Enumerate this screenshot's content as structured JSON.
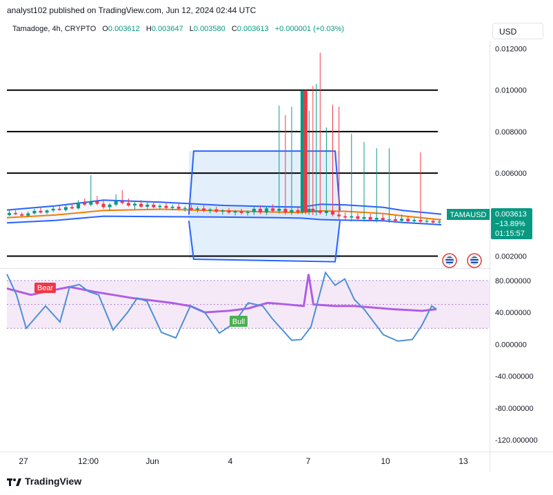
{
  "header": {
    "published": "analyst102 published on TradingView.com, Jun 12, 2024 02:44 UTC"
  },
  "symbol_bar": {
    "name": "Tamadoge, 4h, CRYPTO",
    "open_label": "O",
    "open": "0.003612",
    "high_label": "H",
    "high": "0.003647",
    "low_label": "L",
    "low": "0.003580",
    "close_label": "C",
    "close": "0.003613",
    "change": "+0.000001 (+0.03%)"
  },
  "currency_button": "USD",
  "price_tag": {
    "symbol": "TAMAUSD",
    "price": "0.003613",
    "change_pct": "−13.89%",
    "countdown": "01:15:57"
  },
  "colors": {
    "up": "#089981",
    "down": "#f23645",
    "band": "#2962ff",
    "ma": "#f57c00",
    "rsi": "#b05ce6",
    "stoch": "#4a8fd8",
    "axis_text": "#131722",
    "level_line": "#000000",
    "zone_fill": "#e3f0fb",
    "rsi_band": "#f5e9f7"
  },
  "footer": {
    "brand": "TradingView"
  },
  "chart_data": [
    {
      "type": "candlestick",
      "title": "Tamadoge, 4h, CRYPTO",
      "x_tick_labels": [
        "27",
        "12:00",
        "Jun",
        "4",
        "7",
        "10",
        "13"
      ],
      "y_tick_labels": [
        "0.012000",
        "0.010000",
        "0.008000",
        "0.006000",
        "0.004000",
        "0.002000"
      ],
      "ylim": [
        0.00145,
        0.01235
      ],
      "horizontal_levels": [
        0.01,
        0.008,
        0.006,
        0.002
      ],
      "rectangle_zone": {
        "x_range": [
          0.377,
          0.69
        ],
        "price_top": 0.00706,
        "price_bottom": 0.00185
      },
      "candles": [
        {
          "x": 0.005,
          "open": 0.00398,
          "high": 0.0042,
          "low": 0.00392,
          "close": 0.00408
        },
        {
          "x": 0.018,
          "open": 0.00408,
          "high": 0.00421,
          "low": 0.00398,
          "close": 0.00402
        },
        {
          "x": 0.031,
          "open": 0.00402,
          "high": 0.0041,
          "low": 0.0039,
          "close": 0.00395
        },
        {
          "x": 0.044,
          "open": 0.00395,
          "high": 0.00415,
          "low": 0.00388,
          "close": 0.00406
        },
        {
          "x": 0.057,
          "open": 0.00406,
          "high": 0.00428,
          "low": 0.004,
          "close": 0.00418
        },
        {
          "x": 0.07,
          "open": 0.00418,
          "high": 0.00432,
          "low": 0.00405,
          "close": 0.0041
        },
        {
          "x": 0.083,
          "open": 0.0041,
          "high": 0.00425,
          "low": 0.00402,
          "close": 0.0042
        },
        {
          "x": 0.096,
          "open": 0.0042,
          "high": 0.00438,
          "low": 0.00412,
          "close": 0.00428
        },
        {
          "x": 0.109,
          "open": 0.00428,
          "high": 0.00446,
          "low": 0.0042,
          "close": 0.00422
        },
        {
          "x": 0.122,
          "open": 0.00422,
          "high": 0.00448,
          "low": 0.00415,
          "close": 0.00436
        },
        {
          "x": 0.135,
          "open": 0.00436,
          "high": 0.00454,
          "low": 0.00425,
          "close": 0.0043
        },
        {
          "x": 0.148,
          "open": 0.0043,
          "high": 0.0047,
          "low": 0.00425,
          "close": 0.00458
        },
        {
          "x": 0.161,
          "open": 0.00458,
          "high": 0.00478,
          "low": 0.00442,
          "close": 0.00448
        },
        {
          "x": 0.174,
          "open": 0.00448,
          "high": 0.0059,
          "low": 0.0044,
          "close": 0.00465
        },
        {
          "x": 0.187,
          "open": 0.00465,
          "high": 0.0049,
          "low": 0.00445,
          "close": 0.00452
        },
        {
          "x": 0.2,
          "open": 0.00452,
          "high": 0.00468,
          "low": 0.00428,
          "close": 0.00436
        },
        {
          "x": 0.213,
          "open": 0.00436,
          "high": 0.00456,
          "low": 0.0042,
          "close": 0.00448
        },
        {
          "x": 0.226,
          "open": 0.00448,
          "high": 0.00498,
          "low": 0.0044,
          "close": 0.00464
        },
        {
          "x": 0.239,
          "open": 0.00464,
          "high": 0.00518,
          "low": 0.0045,
          "close": 0.00456
        },
        {
          "x": 0.252,
          "open": 0.00456,
          "high": 0.00478,
          "low": 0.00438,
          "close": 0.00444
        },
        {
          "x": 0.265,
          "open": 0.00444,
          "high": 0.00466,
          "low": 0.00426,
          "close": 0.00452
        },
        {
          "x": 0.278,
          "open": 0.00452,
          "high": 0.0047,
          "low": 0.00432,
          "close": 0.00438
        },
        {
          "x": 0.291,
          "open": 0.00438,
          "high": 0.00462,
          "low": 0.00428,
          "close": 0.00448
        },
        {
          "x": 0.304,
          "open": 0.00448,
          "high": 0.00462,
          "low": 0.0043,
          "close": 0.00436
        },
        {
          "x": 0.317,
          "open": 0.00436,
          "high": 0.0045,
          "low": 0.00424,
          "close": 0.00442
        },
        {
          "x": 0.33,
          "open": 0.00442,
          "high": 0.0046,
          "low": 0.00428,
          "close": 0.00432
        },
        {
          "x": 0.343,
          "open": 0.00432,
          "high": 0.00448,
          "low": 0.0042,
          "close": 0.00438
        },
        {
          "x": 0.356,
          "open": 0.00438,
          "high": 0.00452,
          "low": 0.00424,
          "close": 0.00428
        },
        {
          "x": 0.369,
          "open": 0.00428,
          "high": 0.0044,
          "low": 0.00415,
          "close": 0.00432
        },
        {
          "x": 0.382,
          "open": 0.00432,
          "high": 0.00448,
          "low": 0.00418,
          "close": 0.00424
        },
        {
          "x": 0.395,
          "open": 0.00424,
          "high": 0.0044,
          "low": 0.0041,
          "close": 0.0043
        },
        {
          "x": 0.408,
          "open": 0.0043,
          "high": 0.00445,
          "low": 0.00412,
          "close": 0.00418
        },
        {
          "x": 0.421,
          "open": 0.00418,
          "high": 0.00432,
          "low": 0.00405,
          "close": 0.00425
        },
        {
          "x": 0.434,
          "open": 0.00425,
          "high": 0.00438,
          "low": 0.00408,
          "close": 0.00414
        },
        {
          "x": 0.447,
          "open": 0.00414,
          "high": 0.00426,
          "low": 0.004,
          "close": 0.0042
        },
        {
          "x": 0.46,
          "open": 0.0042,
          "high": 0.00432,
          "low": 0.00402,
          "close": 0.0041
        },
        {
          "x": 0.473,
          "open": 0.0041,
          "high": 0.00422,
          "low": 0.00396,
          "close": 0.00416
        },
        {
          "x": 0.486,
          "open": 0.00416,
          "high": 0.00428,
          "low": 0.004,
          "close": 0.00408
        },
        {
          "x": 0.499,
          "open": 0.00408,
          "high": 0.0042,
          "low": 0.00395,
          "close": 0.00412
        },
        {
          "x": 0.512,
          "open": 0.00412,
          "high": 0.00438,
          "low": 0.00398,
          "close": 0.00428
        },
        {
          "x": 0.525,
          "open": 0.00428,
          "high": 0.00445,
          "low": 0.00402,
          "close": 0.0041
        },
        {
          "x": 0.538,
          "open": 0.0041,
          "high": 0.0044,
          "low": 0.00398,
          "close": 0.0043
        },
        {
          "x": 0.551,
          "open": 0.0043,
          "high": 0.0045,
          "low": 0.0041,
          "close": 0.00418
        },
        {
          "x": 0.564,
          "open": 0.00418,
          "high": 0.00925,
          "low": 0.00405,
          "close": 0.00428
        },
        {
          "x": 0.577,
          "open": 0.00428,
          "high": 0.0088,
          "low": 0.004,
          "close": 0.0041
        },
        {
          "x": 0.59,
          "open": 0.0041,
          "high": 0.0092,
          "low": 0.00398,
          "close": 0.00422
        },
        {
          "x": 0.603,
          "open": 0.00422,
          "high": 0.0044,
          "low": 0.00402,
          "close": 0.00412
        },
        {
          "x": 0.612,
          "open": 0.00412,
          "high": 0.01,
          "low": 0.00402,
          "close": 0.00998
        },
        {
          "x": 0.619,
          "open": 0.00998,
          "high": 0.01005,
          "low": 0.00402,
          "close": 0.00412
        },
        {
          "x": 0.626,
          "open": 0.00412,
          "high": 0.009,
          "low": 0.00398,
          "close": 0.00428
        },
        {
          "x": 0.634,
          "open": 0.00428,
          "high": 0.0102,
          "low": 0.00398,
          "close": 0.00412
        },
        {
          "x": 0.641,
          "open": 0.00412,
          "high": 0.0103,
          "low": 0.00396,
          "close": 0.0042
        },
        {
          "x": 0.649,
          "open": 0.0042,
          "high": 0.0118,
          "low": 0.004,
          "close": 0.00408
        },
        {
          "x": 0.662,
          "open": 0.00408,
          "high": 0.0082,
          "low": 0.00394,
          "close": 0.00418
        },
        {
          "x": 0.675,
          "open": 0.00418,
          "high": 0.0093,
          "low": 0.00392,
          "close": 0.004
        },
        {
          "x": 0.688,
          "open": 0.004,
          "high": 0.0092,
          "low": 0.0038,
          "close": 0.00392
        },
        {
          "x": 0.701,
          "open": 0.00392,
          "high": 0.0041,
          "low": 0.00372,
          "close": 0.00386
        },
        {
          "x": 0.714,
          "open": 0.00386,
          "high": 0.0079,
          "low": 0.00366,
          "close": 0.00392
        },
        {
          "x": 0.727,
          "open": 0.00392,
          "high": 0.00408,
          "low": 0.0037,
          "close": 0.0038
        },
        {
          "x": 0.74,
          "open": 0.0038,
          "high": 0.0075,
          "low": 0.00366,
          "close": 0.00388
        },
        {
          "x": 0.753,
          "open": 0.00388,
          "high": 0.00405,
          "low": 0.00368,
          "close": 0.00376
        },
        {
          "x": 0.766,
          "open": 0.00376,
          "high": 0.0072,
          "low": 0.00362,
          "close": 0.00384
        },
        {
          "x": 0.779,
          "open": 0.00384,
          "high": 0.00402,
          "low": 0.00366,
          "close": 0.00374
        },
        {
          "x": 0.792,
          "open": 0.00374,
          "high": 0.0072,
          "low": 0.0036,
          "close": 0.00378
        },
        {
          "x": 0.805,
          "open": 0.00378,
          "high": 0.00396,
          "low": 0.00362,
          "close": 0.0037
        },
        {
          "x": 0.818,
          "open": 0.0037,
          "high": 0.004,
          "low": 0.0036,
          "close": 0.0038
        },
        {
          "x": 0.831,
          "open": 0.0038,
          "high": 0.00392,
          "low": 0.00358,
          "close": 0.00368
        },
        {
          "x": 0.844,
          "open": 0.00368,
          "high": 0.00385,
          "low": 0.00358,
          "close": 0.00374
        },
        {
          "x": 0.857,
          "open": 0.00374,
          "high": 0.007,
          "low": 0.0036,
          "close": 0.00366
        },
        {
          "x": 0.87,
          "open": 0.00366,
          "high": 0.0038,
          "low": 0.00356,
          "close": 0.0037
        },
        {
          "x": 0.883,
          "open": 0.0037,
          "high": 0.00378,
          "low": 0.00354,
          "close": 0.00362
        },
        {
          "x": 0.896,
          "open": 0.00362,
          "high": 0.00375,
          "low": 0.00355,
          "close": 0.00366
        }
      ],
      "bollinger_upper": [
        [
          0.0,
          0.00422
        ],
        [
          0.1,
          0.00442
        ],
        [
          0.2,
          0.0047
        ],
        [
          0.32,
          0.0046
        ],
        [
          0.45,
          0.00444
        ],
        [
          0.56,
          0.00438
        ],
        [
          0.61,
          0.00436
        ],
        [
          0.65,
          0.0045
        ],
        [
          0.7,
          0.00447
        ],
        [
          0.78,
          0.00435
        ],
        [
          0.82,
          0.0042
        ],
        [
          0.9,
          0.00402
        ]
      ],
      "bollinger_lower": [
        [
          0.0,
          0.0036
        ],
        [
          0.1,
          0.00372
        ],
        [
          0.2,
          0.00392
        ],
        [
          0.32,
          0.0039
        ],
        [
          0.45,
          0.00388
        ],
        [
          0.56,
          0.00385
        ],
        [
          0.61,
          0.00383
        ],
        [
          0.65,
          0.00376
        ],
        [
          0.7,
          0.00373
        ],
        [
          0.78,
          0.0037
        ],
        [
          0.82,
          0.00362
        ],
        [
          0.9,
          0.00351
        ]
      ],
      "moving_average": [
        [
          0.0,
          0.00385
        ],
        [
          0.1,
          0.00398
        ],
        [
          0.2,
          0.0042
        ],
        [
          0.32,
          0.00426
        ],
        [
          0.45,
          0.00418
        ],
        [
          0.56,
          0.00412
        ],
        [
          0.61,
          0.0041
        ],
        [
          0.65,
          0.00418
        ],
        [
          0.7,
          0.00416
        ],
        [
          0.78,
          0.00405
        ],
        [
          0.82,
          0.00394
        ],
        [
          0.9,
          0.00375
        ]
      ]
    },
    {
      "type": "line",
      "title": "",
      "y_tick_labels": [
        "80.000000",
        "40.000000",
        "0.000000",
        "-40.000000",
        "-80.000000",
        "-120.000000"
      ],
      "ylim": [
        -132,
        92
      ],
      "band": [
        20,
        80
      ],
      "labels": [
        "Bear",
        "Bull"
      ],
      "series": [
        {
          "values": [
            [
              0.0,
              70
            ],
            [
              0.05,
              62
            ],
            [
              0.08,
              66
            ],
            [
              0.13,
              72
            ],
            [
              0.18,
              66
            ],
            [
              0.22,
              62
            ],
            [
              0.26,
              58
            ],
            [
              0.3,
              55
            ],
            [
              0.34,
              52
            ],
            [
              0.38,
              48
            ],
            [
              0.41,
              40
            ],
            [
              0.46,
              42
            ],
            [
              0.5,
              45
            ],
            [
              0.54,
              52
            ],
            [
              0.58,
              50
            ],
            [
              0.615,
              48
            ],
            [
              0.625,
              88
            ],
            [
              0.635,
              50
            ],
            [
              0.68,
              48
            ],
            [
              0.72,
              48
            ],
            [
              0.76,
              46
            ],
            [
              0.8,
              44
            ],
            [
              0.86,
              42
            ],
            [
              0.89,
              44
            ]
          ]
        },
        {
          "values": [
            [
              0.0,
              88
            ],
            [
              0.02,
              62
            ],
            [
              0.04,
              20
            ],
            [
              0.08,
              48
            ],
            [
              0.11,
              28
            ],
            [
              0.13,
              72
            ],
            [
              0.15,
              75
            ],
            [
              0.17,
              66
            ],
            [
              0.19,
              62
            ],
            [
              0.22,
              18
            ],
            [
              0.25,
              40
            ],
            [
              0.27,
              58
            ],
            [
              0.29,
              54
            ],
            [
              0.32,
              15
            ],
            [
              0.35,
              8
            ],
            [
              0.38,
              48
            ],
            [
              0.41,
              40
            ],
            [
              0.44,
              14
            ],
            [
              0.47,
              26
            ],
            [
              0.5,
              52
            ],
            [
              0.53,
              48
            ],
            [
              0.55,
              32
            ],
            [
              0.59,
              5
            ],
            [
              0.61,
              6
            ],
            [
              0.63,
              22
            ],
            [
              0.66,
              90
            ],
            [
              0.68,
              74
            ],
            [
              0.7,
              82
            ],
            [
              0.72,
              56
            ],
            [
              0.74,
              44
            ],
            [
              0.78,
              12
            ],
            [
              0.81,
              4
            ],
            [
              0.84,
              6
            ],
            [
              0.86,
              24
            ],
            [
              0.88,
              48
            ],
            [
              0.89,
              44
            ]
          ]
        }
      ]
    }
  ]
}
